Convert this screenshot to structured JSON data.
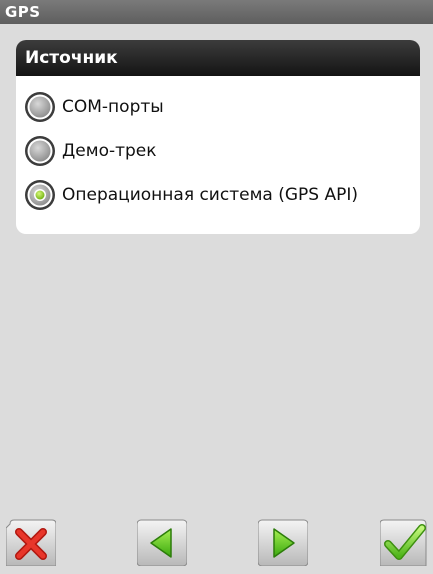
{
  "window": {
    "title": "GPS"
  },
  "source_group": {
    "header": "Источник",
    "options": [
      {
        "label": "COM-порты",
        "selected": false
      },
      {
        "label": "Демо-трек",
        "selected": false
      },
      {
        "label": "Операционная система (GPS API)",
        "selected": true
      }
    ]
  },
  "toolbar": {
    "buttons": [
      {
        "icon": "close-icon"
      },
      {
        "icon": "arrow-left-icon"
      },
      {
        "icon": "arrow-right-icon"
      },
      {
        "icon": "checkmark-icon"
      }
    ]
  },
  "colors": {
    "background": "#dcdcdc",
    "title_bar": "#6b6b6b",
    "group_header": "#1f1f1f",
    "radio_selected": "#8fd41a",
    "cancel_red": "#e3281e",
    "nav_green": "#52c418"
  }
}
